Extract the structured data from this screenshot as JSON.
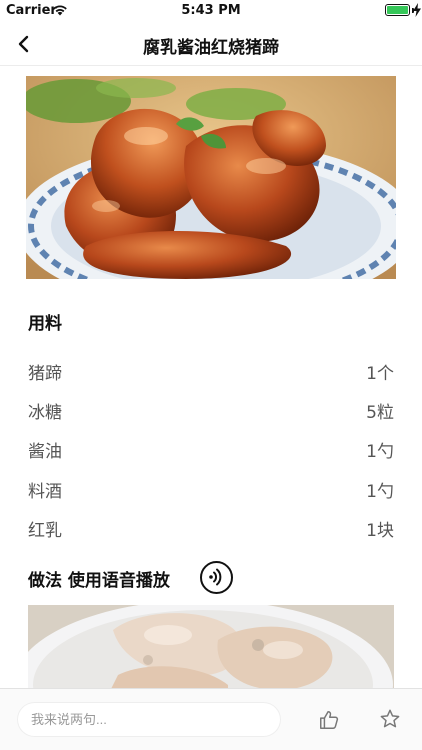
{
  "status_bar": {
    "carrier": "Carrier",
    "time": "5:43 PM",
    "battery_level": 1.0
  },
  "nav": {
    "title": "腐乳酱油红烧猪蹄"
  },
  "ingredients": {
    "title": "用料",
    "items": [
      {
        "name": "猪蹄",
        "amount": "1个"
      },
      {
        "name": "冰糖",
        "amount": "5粒"
      },
      {
        "name": "酱油",
        "amount": "1勺"
      },
      {
        "name": "料酒",
        "amount": "1勺"
      },
      {
        "name": "红乳",
        "amount": "1块"
      }
    ]
  },
  "method": {
    "title": "做法 使用语音播放"
  },
  "bottom_bar": {
    "comment_placeholder": "我来说两句..."
  },
  "icons": {
    "back": "chevron-left-icon",
    "voice": "voice-wave-icon",
    "like": "thumbs-up-icon",
    "favorite": "star-icon"
  },
  "colors": {
    "battery": "#35c759",
    "accent": "#111111"
  }
}
